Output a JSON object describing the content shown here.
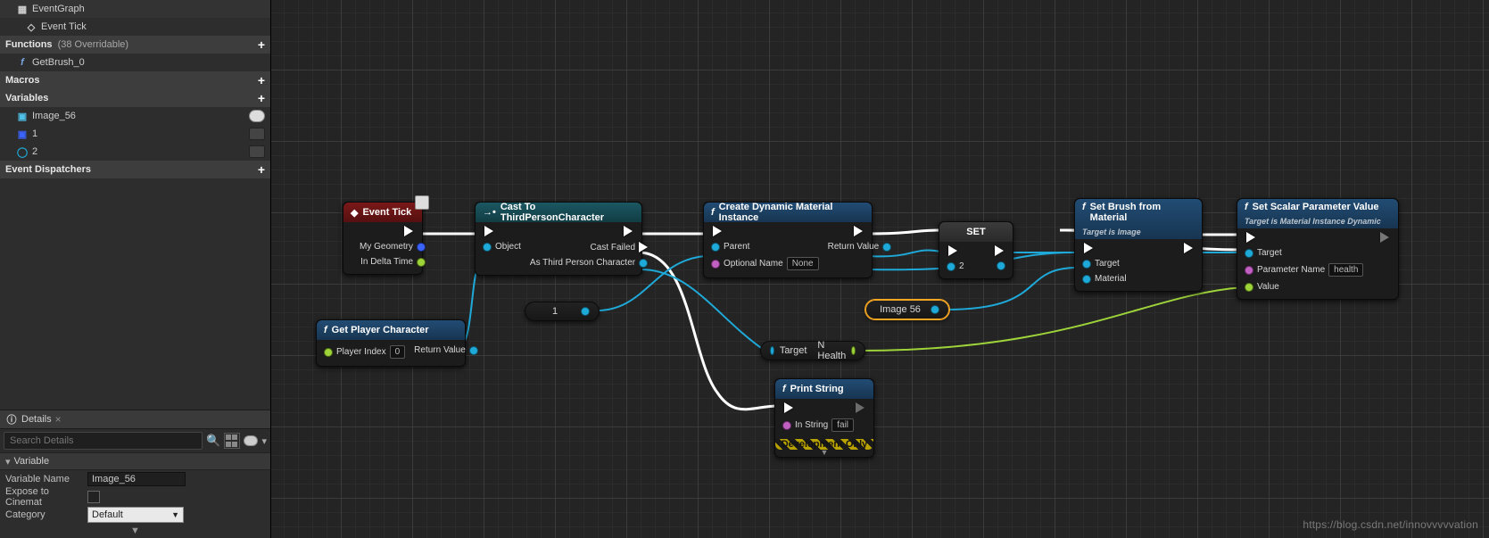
{
  "sidebar": {
    "graph_root": "EventGraph",
    "graph_event": "Event Tick",
    "functions_label": "Functions",
    "functions_sub": "(38 Overridable)",
    "function_item": "GetBrush_0",
    "macros_label": "Macros",
    "variables_label": "Variables",
    "var_image": "Image_56",
    "var_1": "1",
    "var_2": "2",
    "dispatchers_label": "Event Dispatchers"
  },
  "details": {
    "header": "Details",
    "search_placeholder": "Search Details",
    "section_variable": "Variable",
    "prop_name_label": "Variable Name",
    "prop_name_value": "Image_56",
    "prop_expose_label": "Expose to Cinemat",
    "prop_category_label": "Category",
    "prop_category_value": "Default"
  },
  "nodes": {
    "event_tick": {
      "title": "Event Tick",
      "pin_geometry": "My Geometry",
      "pin_delta": "In Delta Time"
    },
    "cast": {
      "title": "Cast To ThirdPersonCharacter",
      "pin_object": "Object",
      "pin_cast_failed": "Cast Failed",
      "pin_as": "As Third Person Character"
    },
    "getplayer": {
      "title": "Get Player Character",
      "pin_index": "Player Index",
      "pin_index_val": "0",
      "pin_return": "Return Value"
    },
    "createdmi": {
      "title": "Create Dynamic Material Instance",
      "pin_parent": "Parent",
      "pin_optname": "Optional Name",
      "pin_optname_val": "None",
      "pin_return": "Return Value"
    },
    "print": {
      "title": "Print String",
      "pin_instring": "In String",
      "pin_instring_val": "fail",
      "devonly": "Development Only"
    },
    "setnode": {
      "title": "SET",
      "pin_2": "2"
    },
    "setbrush": {
      "title": "Set Brush from Material",
      "subtitle": "Target is Image",
      "pin_target": "Target",
      "pin_material": "Material"
    },
    "setscalar": {
      "title": "Set Scalar Parameter Value",
      "subtitle": "Target is Material Instance Dynamic",
      "pin_target": "Target",
      "pin_param": "Parameter Name",
      "pin_param_val": "health",
      "pin_value": "Value"
    },
    "chip_1": "1",
    "chip_image56": "Image 56",
    "chip_target": "Target",
    "chip_nhealth": "N Health"
  },
  "watermark": "https://blog.csdn.net/innovvvvvation"
}
